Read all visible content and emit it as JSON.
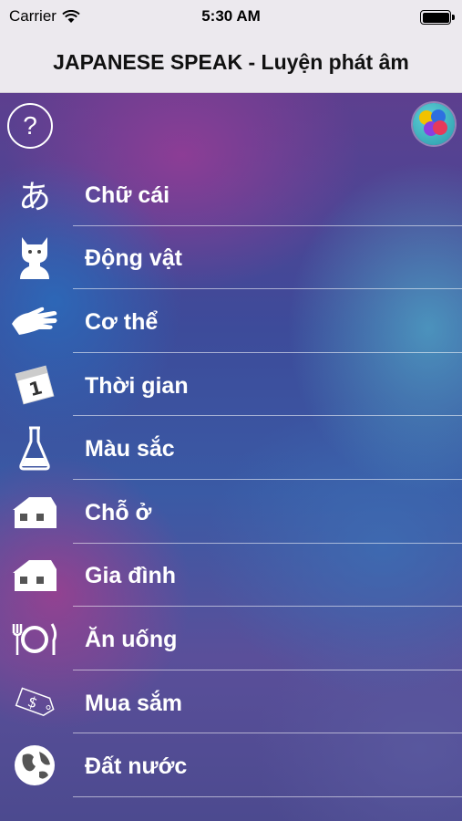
{
  "status_bar": {
    "carrier": "Carrier",
    "time": "5:30 AM"
  },
  "nav": {
    "title": "JAPANESE SPEAK - Luyện phát âm"
  },
  "toolbar": {
    "help_label": "?"
  },
  "menu": {
    "items": [
      {
        "label": "Chữ cái",
        "icon": "hiragana-a-icon",
        "glyph": "あ"
      },
      {
        "label": "Động vật",
        "icon": "cat-icon"
      },
      {
        "label": "Cơ thể",
        "icon": "hand-icon"
      },
      {
        "label": "Thời gian",
        "icon": "calendar-icon",
        "glyph": "1"
      },
      {
        "label": "Màu sắc",
        "icon": "flask-icon"
      },
      {
        "label": "Chỗ ở",
        "icon": "house-icon"
      },
      {
        "label": "Gia đình",
        "icon": "house-icon"
      },
      {
        "label": "Ăn uống",
        "icon": "fork-plate-knife-icon"
      },
      {
        "label": "Mua sắm",
        "icon": "price-tag-icon",
        "glyph": "$"
      },
      {
        "label": "Đất nước",
        "icon": "globe-icon"
      }
    ]
  },
  "colors": {
    "bar_background": "#ece9ee",
    "text_on_bg": "#ffffff"
  }
}
